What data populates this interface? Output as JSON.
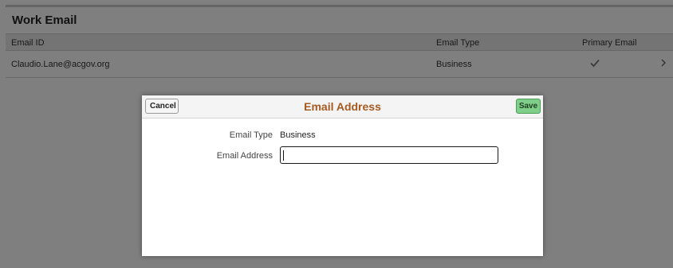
{
  "section": {
    "title": "Work Email",
    "columns": {
      "email_id": "Email ID",
      "email_type": "Email Type",
      "primary_email": "Primary Email"
    },
    "rows": [
      {
        "email_id": "Claudio.Lane@acgov.org",
        "email_type": "Business",
        "primary_icon": "checkmark-icon",
        "chevron_icon": "chevron-right-icon"
      }
    ]
  },
  "modal": {
    "title": "Email Address",
    "cancel_label": "Cancel",
    "save_label": "Save",
    "email_type_label": "Email Type",
    "email_type_value": "Business",
    "email_address_label": "Email Address",
    "email_address_value": "",
    "title_color": "#a45a20",
    "save_color": "#7fcf8a"
  }
}
